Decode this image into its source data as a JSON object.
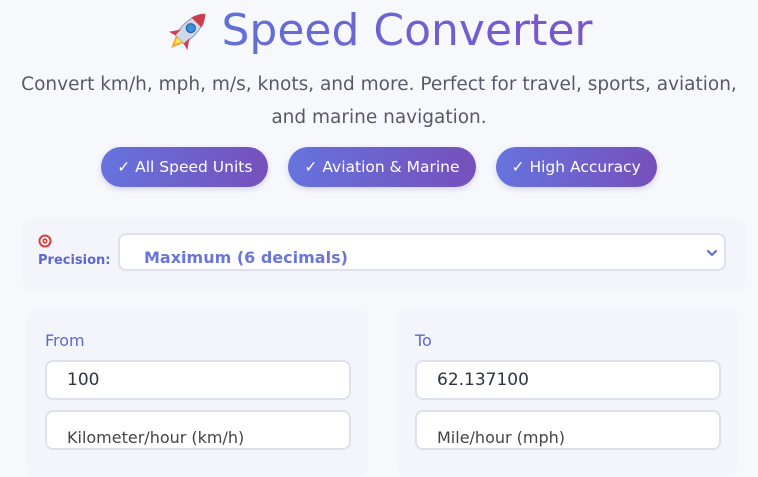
{
  "header": {
    "rocket_icon": "rocket-emoji",
    "title": "Speed Converter",
    "subtitle": "Convert km/h, mph, m/s, knots, and more. Perfect for travel, sports, aviation, and marine navigation."
  },
  "badges": [
    {
      "label": "✓ All Speed Units"
    },
    {
      "label": "✓ Aviation & Marine"
    },
    {
      "label": "✓ High Accuracy"
    }
  ],
  "precision": {
    "icon": "target-icon",
    "label": "Precision:",
    "selected": "Maximum (6 decimals)"
  },
  "from": {
    "label": "From",
    "value": "100",
    "unit": "Kilometer/hour (km/h)"
  },
  "to": {
    "label": "To",
    "value": "62.137100",
    "unit": "Mile/hour (mph)"
  },
  "colors": {
    "accent_start": "#6673de",
    "accent_end": "#7650ba",
    "label_blue": "#5b68d0"
  }
}
